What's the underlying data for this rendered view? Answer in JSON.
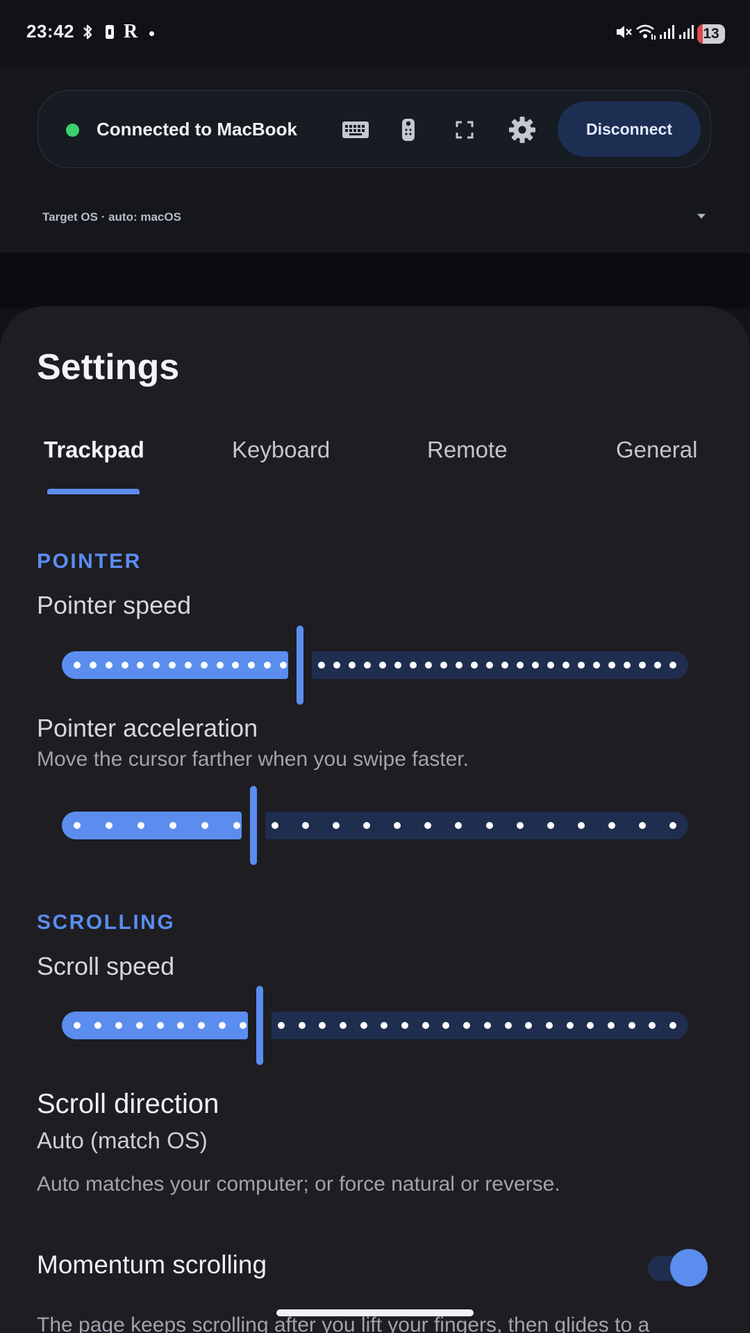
{
  "status_bar": {
    "time": "23:42",
    "left_icons": [
      "bluetooth-icon",
      "vibrate-icon",
      "r-app-icon",
      "notification-dot-icon"
    ],
    "right_icons": [
      "mute-icon",
      "wifi-icon",
      "signal-icon",
      "signal-icon"
    ],
    "battery": "13"
  },
  "connection": {
    "status_color": "#3ccf6e",
    "label": "Connected to MacBook",
    "icons": [
      "keyboard-icon",
      "remote-icon",
      "fullscreen-icon",
      "settings-icon"
    ],
    "disconnect_label": "Disconnect",
    "target_os": "Target OS · auto: macOS"
  },
  "settings": {
    "title": "Settings",
    "tabs": [
      {
        "label": "Trackpad",
        "active": true
      },
      {
        "label": "Keyboard",
        "active": false
      },
      {
        "label": "Remote",
        "active": false
      },
      {
        "label": "General",
        "active": false
      }
    ],
    "pointer": {
      "header": "POINTER",
      "speed": {
        "label": "Pointer speed",
        "value_fraction": 0.375
      },
      "acceleration": {
        "label": "Pointer acceleration",
        "description": "Move the cursor farther when you swipe faster.",
        "value_fraction": 0.3
      }
    },
    "scrolling": {
      "header": "SCROLLING",
      "speed": {
        "label": "Scroll speed",
        "value_fraction": 0.31
      },
      "direction": {
        "label": "Scroll direction",
        "value": "Auto (match OS)",
        "description": "Auto matches your computer; or force natural or reverse."
      },
      "momentum": {
        "label": "Momentum scrolling",
        "enabled": true,
        "description": "The page keeps scrolling after you lift your fingers, then glides to a"
      }
    }
  },
  "colors": {
    "accent": "#5b8def",
    "accent_dim": "#1f2d4f",
    "sheet_bg": "#1e1d22"
  }
}
